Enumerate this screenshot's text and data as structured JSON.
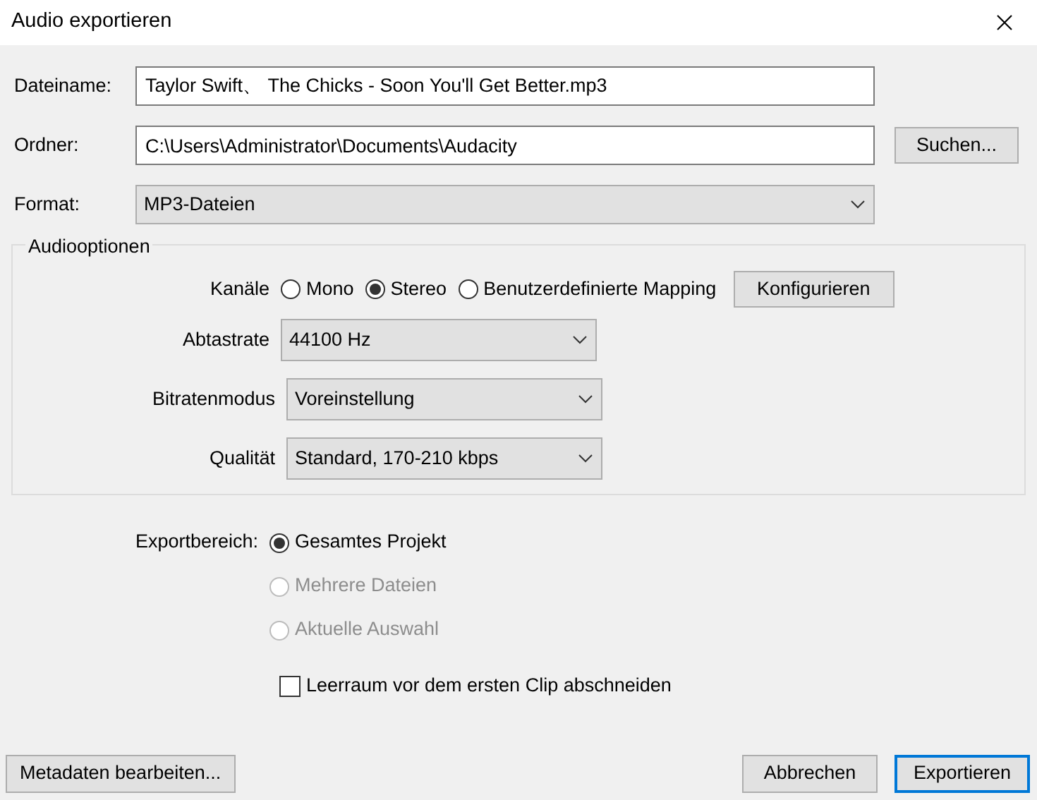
{
  "window": {
    "title": "Audio exportieren"
  },
  "fields": [
    {
      "label": "Dateiname:",
      "kind": "text",
      "value": "Taylor Swift、 The Chicks - Soon You'll Get Better.mp3"
    },
    {
      "label": "Ordner:",
      "kind": "text",
      "value": "C:\\Users\\Administrator\\Documents\\Audacity",
      "button": "Suchen..."
    },
    {
      "label": "Format:",
      "kind": "select",
      "value": "MP3-Dateien"
    }
  ],
  "audio_options": {
    "title": "Audiooptionen",
    "channels": {
      "label": "Kanäle",
      "options": [
        {
          "label": "Mono",
          "selected": false
        },
        {
          "label": "Stereo",
          "selected": true
        },
        {
          "label": "Benutzerdefinierte Mapping",
          "selected": false
        }
      ],
      "button": "Konfigurieren"
    },
    "selects": [
      {
        "label": "Abtastrate",
        "value": "44100 Hz"
      },
      {
        "label": "Bitratenmodus",
        "value": "Voreinstellung"
      },
      {
        "label": "Qualität",
        "value": "Standard, 170-210 kbps"
      }
    ]
  },
  "export_range": {
    "label": "Exportbereich:",
    "options": [
      {
        "label": "Gesamtes Projekt",
        "selected": true,
        "disabled": false
      },
      {
        "label": "Mehrere Dateien",
        "selected": false,
        "disabled": true
      },
      {
        "label": "Aktuelle Auswahl",
        "selected": false,
        "disabled": true
      }
    ]
  },
  "trim": {
    "label": "Leerraum vor dem ersten Clip abschneiden",
    "checked": false
  },
  "left_buttons": [
    {
      "label": "Metadaten bearbeiten...",
      "default": false
    }
  ],
  "right_buttons": [
    {
      "label": "Abbrechen",
      "default": false
    },
    {
      "label": "Exportieren",
      "default": true
    }
  ]
}
